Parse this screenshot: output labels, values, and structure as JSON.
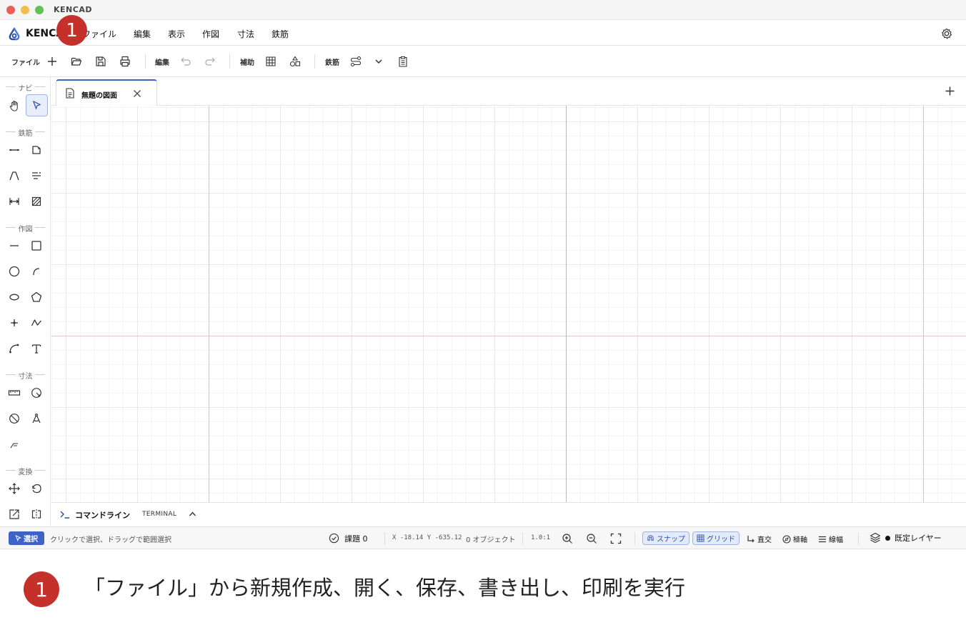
{
  "window": {
    "title": "KENCAD"
  },
  "menubar": {
    "brand": "KENCAD",
    "items": [
      "ファイル",
      "編集",
      "表示",
      "作図",
      "寸法",
      "鉄筋"
    ]
  },
  "toolbar": {
    "file_label": "ファイル",
    "edit_label": "編集",
    "aux_label": "補助",
    "rebar_label": "鉄筋"
  },
  "palette": {
    "sections": {
      "nav": "ナビ",
      "rebar": "鉄筋",
      "draw": "作図",
      "dimension": "寸法",
      "transform": "変換"
    }
  },
  "tabs": [
    {
      "label": "無題の図面"
    }
  ],
  "commandline": {
    "title": "コマンドライン",
    "terminal": "TERMINAL"
  },
  "statusbar": {
    "mode": "選択",
    "hint": "クリックで選択、ドラッグで範囲選択",
    "issues": "課題 0",
    "coords": "X -18.14  Y -635.12",
    "objects": "0 オブジェクト",
    "scale": "1.0:1",
    "snap": "スナップ",
    "grid": "グリッド",
    "ortho": "直交",
    "polar": "極軸",
    "lineweight": "線幅",
    "layer": "既定レイヤー"
  },
  "annotation": {
    "marker": "1",
    "caption": "「ファイル」から新規作成、開く、保存、書き出し、印刷を実行"
  },
  "colors": {
    "accent": "#3b64c6",
    "badge": "#c6302b",
    "axis_x": "#e3c4c8"
  }
}
